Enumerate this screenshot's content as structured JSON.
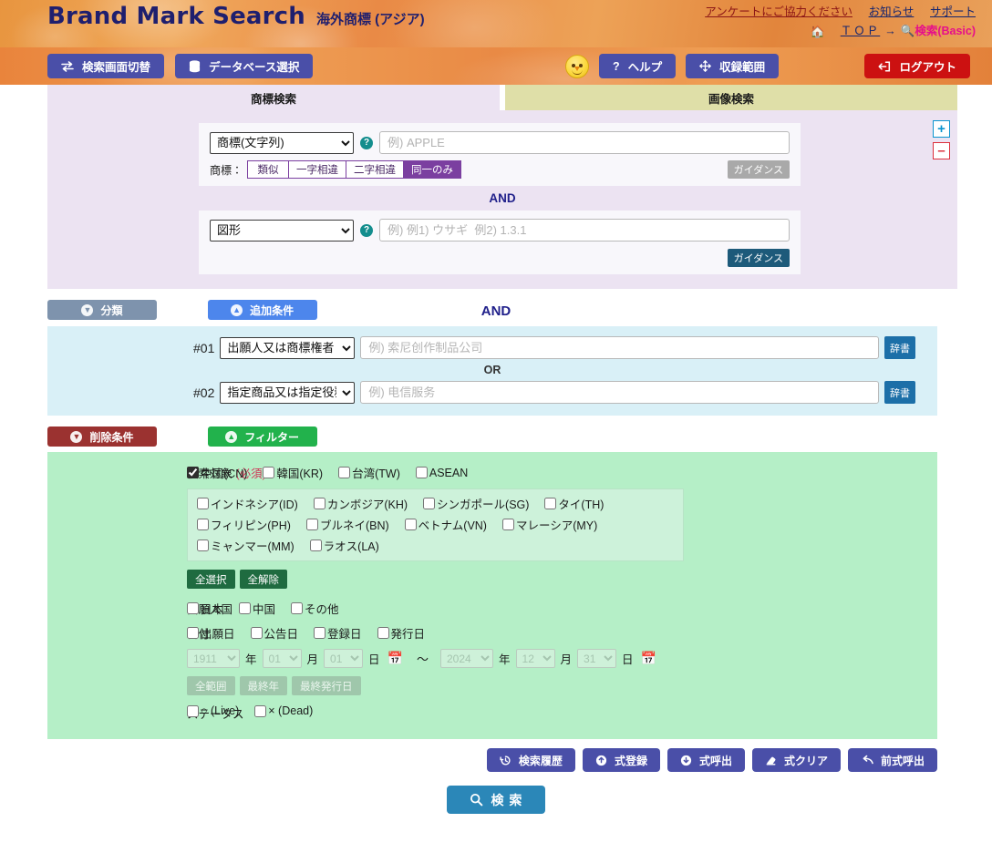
{
  "header": {
    "brand_title": "Brand Mark Search",
    "brand_subtitle": "海外商標 (アジア)",
    "links": [
      {
        "label": "アンケートにご協力ください",
        "style": "survey"
      },
      {
        "label": "お知らせ",
        "style": "plain"
      },
      {
        "label": "サポート",
        "style": "plain"
      }
    ],
    "breadcrumb": {
      "home_icon": "home-icon",
      "top": "ＴＯＰ",
      "arrow": "→",
      "current_icon": "search-icon",
      "current": "検索(Basic)"
    }
  },
  "toolbar": {
    "switch_screen": "検索画面切替",
    "switch_screen_icon": "swap-icon",
    "database_select": "データベース選択",
    "database_icon": "database-icon",
    "mascot": "chick-mascot-icon",
    "help": "ヘルプ",
    "help_icon": "question-icon",
    "coverage": "収録範囲",
    "coverage_icon": "move-icon",
    "logout": "ログアウト",
    "logout_icon": "logout-icon"
  },
  "tabs": [
    {
      "label": "商標検索",
      "active": true
    },
    {
      "label": "画像検索",
      "active": false
    }
  ],
  "search_panel": {
    "row1": {
      "field_selected": "商標(文字列)",
      "field_options": [
        "商標(文字列)",
        "図形",
        "出願人又は商標権者",
        "指定商品又は指定役務"
      ],
      "help_icon": "question-circle-icon",
      "placeholder": "例) APPLE",
      "value": "",
      "match_label": "商標：",
      "match_options": [
        {
          "label": "類似",
          "on": false
        },
        {
          "label": "一字相違",
          "on": false
        },
        {
          "label": "二字相違",
          "on": false
        },
        {
          "label": "同一のみ",
          "on": true
        }
      ],
      "guidance": "ガイダンス",
      "guidance_enabled": false
    },
    "operator": "AND",
    "row2": {
      "field_selected": "図形",
      "field_options": [
        "図形",
        "商標(文字列)"
      ],
      "help_icon": "question-circle-icon",
      "placeholder": "例) 例1) ウサギ  例2) 1.3.1",
      "value": "",
      "guidance": "ガイダンス",
      "guidance_enabled": true
    },
    "add_row_icon": "plus-icon",
    "remove_row_icon": "minus-icon"
  },
  "sections": {
    "classification": {
      "label": "分類",
      "expanded": false,
      "chevron": "chevron-down-icon"
    },
    "additional": {
      "label": "追加条件",
      "expanded": true,
      "chevron": "chevron-up-icon"
    },
    "delete": {
      "label": "削除条件",
      "expanded": false,
      "chevron": "chevron-down-icon"
    },
    "filter": {
      "label": "フィルター",
      "expanded": true,
      "chevron": "chevron-up-icon"
    }
  },
  "additional": {
    "operator_top": "AND",
    "operator_mid": "OR",
    "rows": [
      {
        "index": "#01",
        "field_selected": "出願人又は商標権者",
        "field_options": [
          "出願人又は商標権者",
          "指定商品又は指定役務"
        ],
        "placeholder": "例) 索尼创作制品公司",
        "value": "",
        "dict": "辞書"
      },
      {
        "index": "#02",
        "field_selected": "指定商品又は指定役務",
        "field_options": [
          "指定商品又は指定役務",
          "出願人又は商標権者"
        ],
        "placeholder": "例) 电信服务",
        "value": "",
        "dict": "辞書"
      }
    ]
  },
  "filter": {
    "target": {
      "label": "検索対象",
      "required": "(必須)",
      "primary": [
        {
          "label": "中国(CN)",
          "checked": true
        },
        {
          "label": "韓国(KR)",
          "checked": false
        },
        {
          "label": "台湾(TW)",
          "checked": false
        },
        {
          "label": "ASEAN",
          "checked": false
        }
      ],
      "asean_rows": [
        [
          {
            "label": "インドネシア(ID)",
            "checked": false
          },
          {
            "label": "カンボジア(KH)",
            "checked": false
          },
          {
            "label": "シンガポール(SG)",
            "checked": false
          },
          {
            "label": "タイ(TH)",
            "checked": false
          }
        ],
        [
          {
            "label": "フィリピン(PH)",
            "checked": false
          },
          {
            "label": "ブルネイ(BN)",
            "checked": false
          },
          {
            "label": "ベトナム(VN)",
            "checked": false
          },
          {
            "label": "マレーシア(MY)",
            "checked": false
          }
        ],
        [
          {
            "label": "ミャンマー(MM)",
            "checked": false
          },
          {
            "label": "ラオス(LA)",
            "checked": false
          }
        ]
      ],
      "select_all": "全選択",
      "deselect_all": "全解除"
    },
    "applicant_country": {
      "label": "出願人国",
      "options": [
        {
          "label": "日本",
          "checked": false
        },
        {
          "label": "中国",
          "checked": false
        },
        {
          "label": "その他",
          "checked": false
        }
      ]
    },
    "date": {
      "label": "日付",
      "options": [
        {
          "label": "出願日",
          "checked": false
        },
        {
          "label": "公告日",
          "checked": false
        },
        {
          "label": "登録日",
          "checked": false
        },
        {
          "label": "発行日",
          "checked": false
        }
      ],
      "from": {
        "year": "1911",
        "month": "01",
        "day": "01"
      },
      "to": {
        "year": "2024",
        "month": "12",
        "day": "31"
      },
      "unit_year": "年",
      "unit_month": "月",
      "unit_day": "日",
      "range_sep": "～",
      "calendar_icon": "calendar-icon",
      "buttons": [
        {
          "label": "全範囲",
          "enabled": false
        },
        {
          "label": "最終年",
          "enabled": false
        },
        {
          "label": "最終発行日",
          "enabled": false
        }
      ]
    },
    "status": {
      "label": "ステータス",
      "options": [
        {
          "label": "○ (Live)",
          "checked": false
        },
        {
          "label": "× (Dead)",
          "checked": false
        }
      ]
    }
  },
  "bottom_buttons": [
    {
      "label": "検索履歴",
      "icon": "history-icon"
    },
    {
      "label": "式登録",
      "icon": "upload-icon"
    },
    {
      "label": "式呼出",
      "icon": "download-icon"
    },
    {
      "label": "式クリア",
      "icon": "eraser-icon"
    },
    {
      "label": "前式呼出",
      "icon": "undo-icon"
    }
  ],
  "search_button": {
    "label": "検 索",
    "icon": "search-icon"
  },
  "colors": {
    "header_orange": "#e9903f",
    "brand_navy": "#1f1f6e",
    "toolbar_blue": "#4a4fa8",
    "logout_red": "#cc1111",
    "tab_active": "#ece3f2",
    "tab_inactive": "#dfdfa8",
    "panel_lavender": "#ece3f2",
    "panel_cyan": "#d9f0f7",
    "panel_green": "#b5efc7",
    "accent_purple": "#7b3fa0",
    "accent_pink": "#e60f8a",
    "search_blue": "#2b87b8",
    "filter_green": "#22b24c",
    "delete_maroon": "#9b3230",
    "add_blue": "#4d86ec",
    "class_slate": "#7e93ad"
  }
}
